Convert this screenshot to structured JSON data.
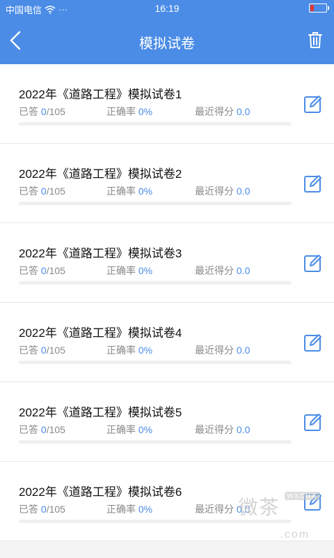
{
  "status_bar": {
    "signal_text": "䷄%",
    "carrier": "中国电信",
    "more": "···",
    "time": "16:19",
    "battery_level": 0.2
  },
  "nav": {
    "title": "模拟试卷"
  },
  "papers": [
    {
      "title": "2022年《道路工程》模拟试卷1",
      "answered_label": "已答 ",
      "answered": "0",
      "total": "/105",
      "accuracy_label": "正确率 ",
      "accuracy": "0%",
      "score_label": "最近得分 ",
      "score": "0.0",
      "progress": 0
    },
    {
      "title": "2022年《道路工程》模拟试卷2",
      "answered_label": "已答 ",
      "answered": "0",
      "total": "/105",
      "accuracy_label": "正确率 ",
      "accuracy": "0%",
      "score_label": "最近得分 ",
      "score": "0.0",
      "progress": 0
    },
    {
      "title": "2022年《道路工程》模拟试卷3",
      "answered_label": "已答 ",
      "answered": "0",
      "total": "/105",
      "accuracy_label": "正确率 ",
      "accuracy": "0%",
      "score_label": "最近得分 ",
      "score": "0.0",
      "progress": 0
    },
    {
      "title": "2022年《道路工程》模拟试卷4",
      "answered_label": "已答 ",
      "answered": "0",
      "total": "/105",
      "accuracy_label": "正确率 ",
      "accuracy": "0%",
      "score_label": "最近得分 ",
      "score": "0.0",
      "progress": 0
    },
    {
      "title": "2022年《道路工程》模拟试卷5",
      "answered_label": "已答 ",
      "answered": "0",
      "total": "/105",
      "accuracy_label": "正确率 ",
      "accuracy": "0%",
      "score_label": "最近得分 ",
      "score": "0.0",
      "progress": 0
    },
    {
      "title": "2022年《道路工程》模拟试卷6",
      "answered_label": "已答 ",
      "answered": "0",
      "total": "/105",
      "accuracy_label": "正确率 ",
      "accuracy": "0%",
      "score_label": "最近得分 ",
      "score": "0.0",
      "progress": 0
    }
  ],
  "watermark": {
    "text": "微茶",
    "tag": "WXCHA",
    "domain": ".com"
  },
  "colors": {
    "primary": "#4a8ce6",
    "value": "#4a8ce6",
    "muted": "#888888"
  },
  "icons": {
    "back": "chevron-left-icon",
    "trash": "trash-icon",
    "edit": "edit-icon",
    "wifi": "wifi-icon",
    "battery": "battery-icon"
  }
}
